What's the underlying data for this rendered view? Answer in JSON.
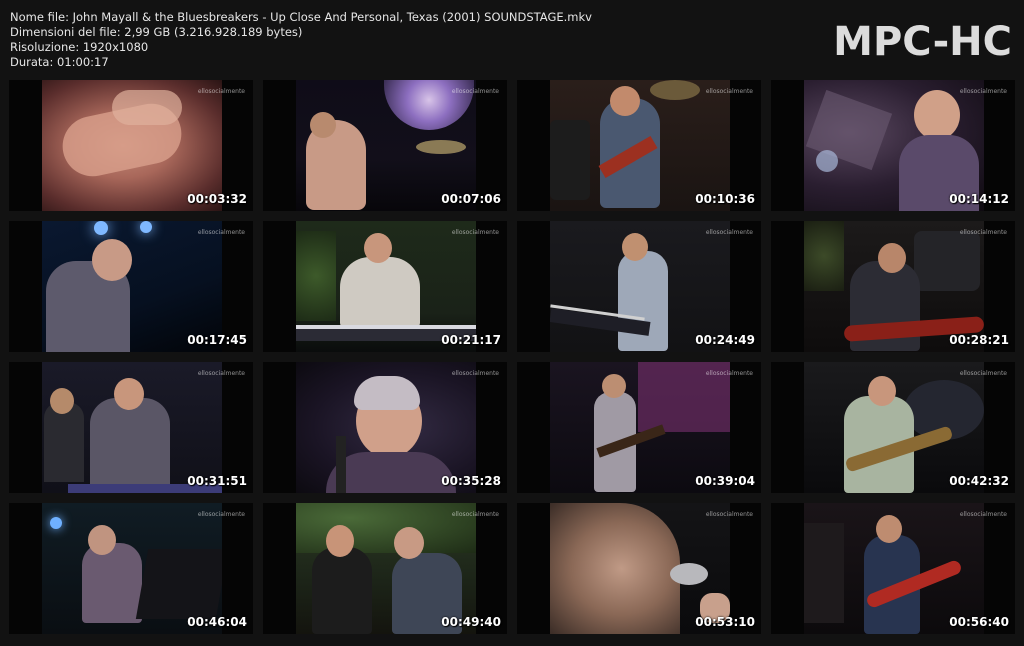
{
  "info": {
    "filename": "Nome file: John Mayall & the Bluesbreakers - Up Close And Personal, Texas (2001) SOUNDSTAGE.mkv",
    "filesize": "Dimensioni del file: 2,99 GB (3.216.928.189 bytes)",
    "resolution": "Risoluzione: 1920x1080",
    "duration": "Durata: 01:00:17"
  },
  "brand": "MPC-HC",
  "thumbnails": [
    {
      "time": "00:03:32",
      "scene": "closeup-hand"
    },
    {
      "time": "00:07:06",
      "scene": "neon-sign-singer"
    },
    {
      "time": "00:10:36",
      "scene": "guitarist-drums"
    },
    {
      "time": "00:14:12",
      "scene": "singer-star-sign"
    },
    {
      "time": "00:17:45",
      "scene": "singer-blue-lights"
    },
    {
      "time": "00:21:17",
      "scene": "keyboard-christmas-tree"
    },
    {
      "time": "00:24:49",
      "scene": "keyboard-side"
    },
    {
      "time": "00:28:21",
      "scene": "bassist"
    },
    {
      "time": "00:31:51",
      "scene": "singer-keyboard-duo"
    },
    {
      "time": "00:35:28",
      "scene": "singer-closeup"
    },
    {
      "time": "00:39:04",
      "scene": "guitarist-purple"
    },
    {
      "time": "00:42:32",
      "scene": "singer-guitar-drums"
    },
    {
      "time": "00:46:04",
      "scene": "piano-stage"
    },
    {
      "time": "00:49:40",
      "scene": "interview-palms"
    },
    {
      "time": "00:53:10",
      "scene": "singer-mic-closeup"
    },
    {
      "time": "00:56:40",
      "scene": "guitarist-red-guitar"
    }
  ],
  "watermark": "ellosocialmente"
}
